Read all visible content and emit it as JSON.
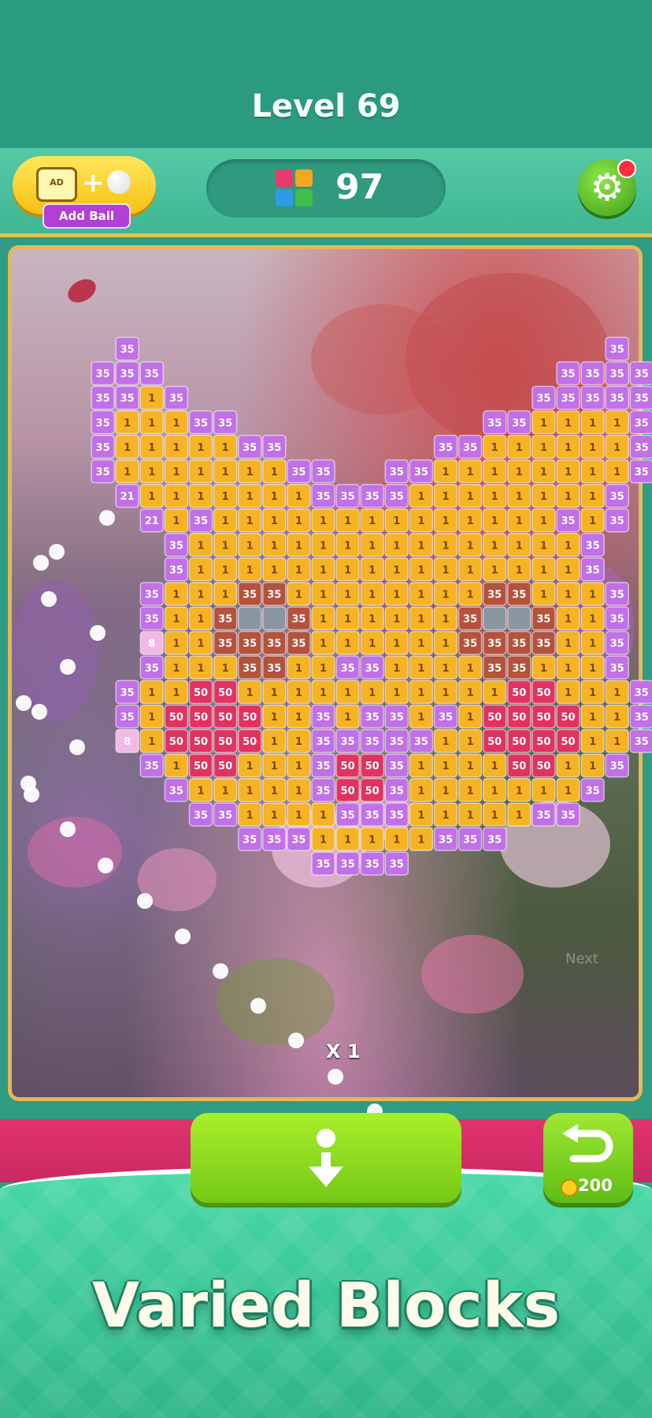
{
  "header": {
    "level_title": "Level 69"
  },
  "hud": {
    "add_ball_label": "Add Ball",
    "ad_icon_text": "AD",
    "plus": "+",
    "score": "97",
    "settings_icon": "gear-icon",
    "settings_has_notification": true
  },
  "board": {
    "multiplier": "X 1",
    "faint_text": "Next",
    "legend": {
      ".": "empty",
      "P": "purple block 35",
      "Y": "yellow block 1",
      "R": "red block 50",
      "B": "brown block 35",
      "G": "grey slab",
      "a": "purple block 21",
      "b": "pink block 8"
    },
    "block_values": {
      "P": "35",
      "Y": "1",
      "R": "50",
      "B": "35",
      "G": "",
      "a": "21",
      "b": "8"
    },
    "colors": {
      "P": "#c170e8",
      "Y": "#f6b324",
      "R": "#e2325f",
      "B": "#b4523c",
      "G": "#8a97a0",
      "a": "#c170e8",
      "b": "#f2b8e8"
    },
    "grid": [
      "..P...................P..",
      ".PPP................PPPP.",
      ".PPYP..............PPPPP.",
      ".PYYYPP..........PPYYYYP.",
      ".PYYYYYPP......PPYYYYYYP.",
      ".PYYYYYYYPP..PPYYYYYYYYP.",
      "..aYYYYYYYPPPPYYYYYYYYP..",
      "...aYPYYYYYYYYYYYYYYPYP..",
      "....PYYYYYYYYYYYYYYYYP...",
      "....PYYYYYYYYYYYYYYYYP...",
      "...PYYYBBYYYYYYYYBBYYYP..",
      "...PYYBGGBYYYYYYBGGBYYP..",
      "...bYYBBBBYYYYYYBBBBYYP..",
      "...PYYYBBYYPPYYYYBBYYYP..",
      "..PYYRRYYYYYYYYYYYRRYYYP.",
      "..PYRRRRYYPYPPYPYRRRRYYP.",
      "..bYRRRRYYPPPPPYYRRRRYYP.",
      "...PYRRYYYPRRPYYYYRRYYP..",
      "....PYYYYYPRRPYYYYYYYP...",
      ".....PPYYYYPPPYYYYYPP....",
      ".......PPPYYYYYPPP.......",
      "..........PPPP..........."
    ],
    "balls_remaining_in_trail": 20
  },
  "controls": {
    "drop_icon": "drop-arrow-icon",
    "undo_icon": "undo-icon",
    "undo_cost": "200"
  },
  "banner": {
    "text": "Varied Blocks"
  }
}
